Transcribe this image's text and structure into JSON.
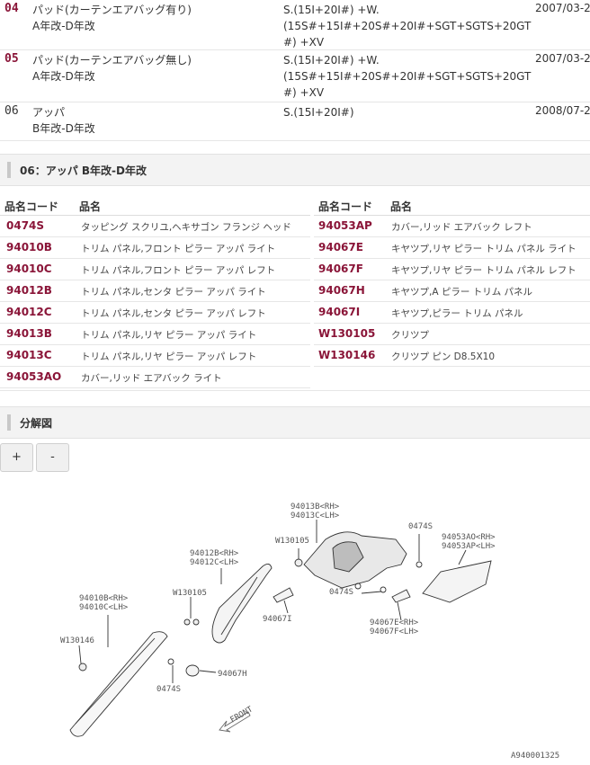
{
  "variants": [
    {
      "no": "04",
      "highlight": true,
      "name1": "パッド(カーテンエアバッグ有り)",
      "name2": "A年改-D年改",
      "model1": "S.(15I+20I#) +W.",
      "model2": "(15S#+15I#+20S#+20I#+SGT+SGTS+20GT",
      "model3": "#) +XV",
      "date": "2007/03-2"
    },
    {
      "no": "05",
      "highlight": true,
      "name1": "パッド(カーテンエアバッグ無し)",
      "name2": "A年改-D年改",
      "model1": "S.(15I+20I#) +W.",
      "model2": "(15S#+15I#+20S#+20I#+SGT+SGTS+20GT",
      "model3": "#) +XV",
      "date": "2007/03-2"
    },
    {
      "no": "06",
      "highlight": false,
      "name1": "アッパ",
      "name2": "B年改-D年改",
      "model1": "S.(15I+20I#)",
      "model2": "",
      "model3": "",
      "date": "2008/07-2"
    }
  ],
  "section1_title": "06：アッパ B年改-D年改",
  "section2_title": "分解図",
  "col_code": "品名コード",
  "col_name": "品名",
  "parts_left": [
    {
      "code": "0474S",
      "name": "タッピング スクリユ,ヘキサゴン フランジ ヘッド"
    },
    {
      "code": "94010B",
      "name": "トリム パネル,フロント ピラー アッパ ライト"
    },
    {
      "code": "94010C",
      "name": "トリム パネル,フロント ピラー アッパ レフト"
    },
    {
      "code": "94012B",
      "name": "トリム パネル,センタ ピラー アッパ ライト"
    },
    {
      "code": "94012C",
      "name": "トリム パネル,センタ ピラー アッパ レフト"
    },
    {
      "code": "94013B",
      "name": "トリム パネル,リヤ ピラー アッパ ライト"
    },
    {
      "code": "94013C",
      "name": "トリム パネル,リヤ ピラー アッパ レフト"
    },
    {
      "code": "94053AO",
      "name": "カバー,リッド エアバック ライト"
    }
  ],
  "parts_right": [
    {
      "code": "94053AP",
      "name": "カバー,リッド エアバック レフト"
    },
    {
      "code": "94067E",
      "name": "キヤツプ,リヤ ピラー トリム パネル ライト"
    },
    {
      "code": "94067F",
      "name": "キヤツプ,リヤ ピラー トリム パネル レフト"
    },
    {
      "code": "94067H",
      "name": "キヤツプ,A ピラー トリム パネル"
    },
    {
      "code": "94067I",
      "name": "キヤツプ,ピラー トリム パネル"
    },
    {
      "code": "W130105",
      "name": "クリツプ"
    },
    {
      "code": "W130146",
      "name": "クリツプ ピン D8.5X10"
    }
  ],
  "zoom_in": "+",
  "zoom_out": "-",
  "diagram": {
    "labels": {
      "l94013b": "94013B<RH>",
      "l94013c": "94013C<LH>",
      "lw130105a": "W130105",
      "l0474sa": "0474S",
      "l94053ao": "94053AO<RH>",
      "l94053ap": "94053AP<LH>",
      "l94012b": "94012B<RH>",
      "l94012c": "94012C<LH>",
      "lw130105b": "W130105",
      "l0474sb": "0474S",
      "l94067i": "94067I",
      "l94067e": "94067E<RH>",
      "l94067f": "94067F<LH>",
      "l94010b": "94010B<RH>",
      "l94010c": "94010C<LH>",
      "lw130146": "W130146",
      "l0474sc": "0474S",
      "l94067h": "94067H",
      "front": "FRONT",
      "figno": "A940001325"
    }
  }
}
